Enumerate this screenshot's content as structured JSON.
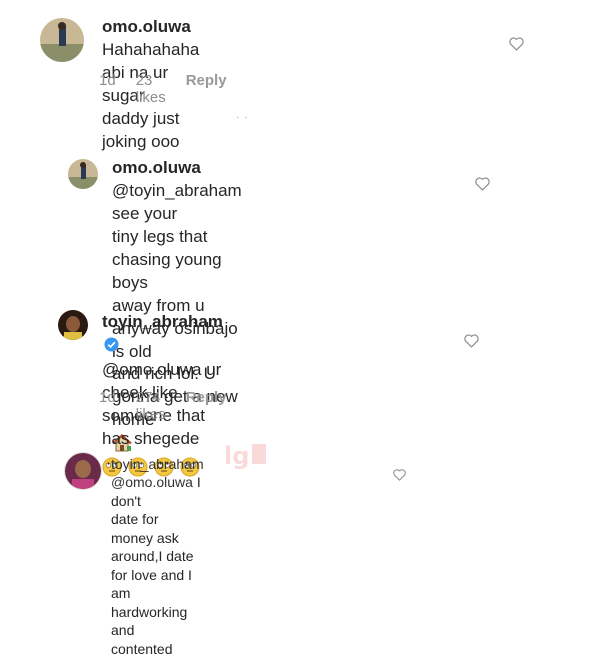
{
  "comments": [
    {
      "username": "omo.oluwa",
      "text_line1": "Hahahahaha abi na ur sugar",
      "text_line2": "daddy just joking ooo",
      "time": "1d",
      "likes": "23 likes",
      "reply": "Reply"
    },
    {
      "username": "omo.oluwa",
      "mention": "@toyin_abraham",
      "text_line1": "see your",
      "text_line2": "tiny legs that chasing young boys",
      "text_line3": "away from u anyway osinbajo is old",
      "text_line4": "and rich lol. U gonna get a new home",
      "emoji": "house-emoji"
    },
    {
      "username": "toyin_abraham",
      "mention": "@omo.oluwa",
      "text_line1": "ur",
      "text_line2": "cheek like someone that has shegede",
      "emoji": "rolling-eyes-emoji",
      "time": "1d",
      "likes": "274 likes",
      "reply": "Reply"
    },
    {
      "username": "toyin_abraham",
      "mention": "@omo.oluwa",
      "text_line1": "I don't",
      "text_line2": "date for money ask around,I date",
      "text_line3": "for love and I am hardworking and",
      "text_line4": "contented"
    }
  ],
  "colors": {
    "text": "#262626",
    "meta": "#8e8e8e",
    "verified": "#3897f0",
    "watermark": "#e53935"
  }
}
